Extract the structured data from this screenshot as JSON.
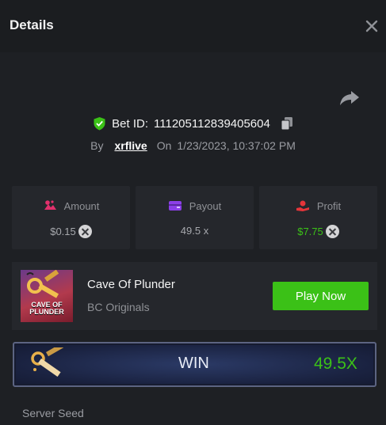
{
  "header": {
    "title": "Details"
  },
  "bet": {
    "id_label": "Bet ID:",
    "id_value": "111205112839405604"
  },
  "byline": {
    "by": "By",
    "user": "xrflive",
    "on": "On",
    "timestamp": "1/23/2023, 10:37:02 PM"
  },
  "stats": {
    "amount": {
      "label": "Amount",
      "value": "$0.15",
      "icon": "amount-icon",
      "color": "#e2306c"
    },
    "payout": {
      "label": "Payout",
      "value": "49.5 x",
      "icon": "wallet-icon",
      "color": "#8c3fe8"
    },
    "profit": {
      "label": "Profit",
      "value": "$7.75",
      "icon": "profit-hand-icon",
      "color": "#e5353a",
      "value_color": "#3bc117"
    }
  },
  "game": {
    "name": "Cave Of Plunder",
    "provider": "BC Originals",
    "thumb_line1": "CAVE OF",
    "thumb_line2": "PLUNDER",
    "play_label": "Play Now"
  },
  "result": {
    "label": "WIN",
    "multiplier": "49.5X"
  },
  "section": {
    "server_seed": "Server Seed"
  },
  "colors": {
    "accent_green": "#3bc117",
    "background": "#1e2024",
    "panel": "#25272c"
  }
}
